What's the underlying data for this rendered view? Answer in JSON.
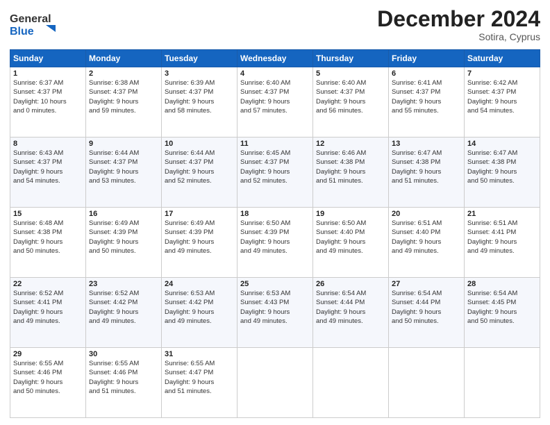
{
  "header": {
    "logo_line1": "General",
    "logo_line2": "Blue",
    "month": "December 2024",
    "location": "Sotira, Cyprus"
  },
  "weekdays": [
    "Sunday",
    "Monday",
    "Tuesday",
    "Wednesday",
    "Thursday",
    "Friday",
    "Saturday"
  ],
  "weeks": [
    [
      {
        "day": "1",
        "sr": "6:37 AM",
        "ss": "4:37 PM",
        "dl": "10 hours and 0 minutes."
      },
      {
        "day": "2",
        "sr": "6:38 AM",
        "ss": "4:37 PM",
        "dl": "9 hours and 59 minutes."
      },
      {
        "day": "3",
        "sr": "6:39 AM",
        "ss": "4:37 PM",
        "dl": "9 hours and 58 minutes."
      },
      {
        "day": "4",
        "sr": "6:40 AM",
        "ss": "4:37 PM",
        "dl": "9 hours and 57 minutes."
      },
      {
        "day": "5",
        "sr": "6:40 AM",
        "ss": "4:37 PM",
        "dl": "9 hours and 56 minutes."
      },
      {
        "day": "6",
        "sr": "6:41 AM",
        "ss": "4:37 PM",
        "dl": "9 hours and 55 minutes."
      },
      {
        "day": "7",
        "sr": "6:42 AM",
        "ss": "4:37 PM",
        "dl": "9 hours and 54 minutes."
      }
    ],
    [
      {
        "day": "8",
        "sr": "6:43 AM",
        "ss": "4:37 PM",
        "dl": "9 hours and 54 minutes."
      },
      {
        "day": "9",
        "sr": "6:44 AM",
        "ss": "4:37 PM",
        "dl": "9 hours and 53 minutes."
      },
      {
        "day": "10",
        "sr": "6:44 AM",
        "ss": "4:37 PM",
        "dl": "9 hours and 52 minutes."
      },
      {
        "day": "11",
        "sr": "6:45 AM",
        "ss": "4:37 PM",
        "dl": "9 hours and 52 minutes."
      },
      {
        "day": "12",
        "sr": "6:46 AM",
        "ss": "4:38 PM",
        "dl": "9 hours and 51 minutes."
      },
      {
        "day": "13",
        "sr": "6:47 AM",
        "ss": "4:38 PM",
        "dl": "9 hours and 51 minutes."
      },
      {
        "day": "14",
        "sr": "6:47 AM",
        "ss": "4:38 PM",
        "dl": "9 hours and 50 minutes."
      }
    ],
    [
      {
        "day": "15",
        "sr": "6:48 AM",
        "ss": "4:38 PM",
        "dl": "9 hours and 50 minutes."
      },
      {
        "day": "16",
        "sr": "6:49 AM",
        "ss": "4:39 PM",
        "dl": "9 hours and 50 minutes."
      },
      {
        "day": "17",
        "sr": "6:49 AM",
        "ss": "4:39 PM",
        "dl": "9 hours and 49 minutes."
      },
      {
        "day": "18",
        "sr": "6:50 AM",
        "ss": "4:39 PM",
        "dl": "9 hours and 49 minutes."
      },
      {
        "day": "19",
        "sr": "6:50 AM",
        "ss": "4:40 PM",
        "dl": "9 hours and 49 minutes."
      },
      {
        "day": "20",
        "sr": "6:51 AM",
        "ss": "4:40 PM",
        "dl": "9 hours and 49 minutes."
      },
      {
        "day": "21",
        "sr": "6:51 AM",
        "ss": "4:41 PM",
        "dl": "9 hours and 49 minutes."
      }
    ],
    [
      {
        "day": "22",
        "sr": "6:52 AM",
        "ss": "4:41 PM",
        "dl": "9 hours and 49 minutes."
      },
      {
        "day": "23",
        "sr": "6:52 AM",
        "ss": "4:42 PM",
        "dl": "9 hours and 49 minutes."
      },
      {
        "day": "24",
        "sr": "6:53 AM",
        "ss": "4:42 PM",
        "dl": "9 hours and 49 minutes."
      },
      {
        "day": "25",
        "sr": "6:53 AM",
        "ss": "4:43 PM",
        "dl": "9 hours and 49 minutes."
      },
      {
        "day": "26",
        "sr": "6:54 AM",
        "ss": "4:44 PM",
        "dl": "9 hours and 49 minutes."
      },
      {
        "day": "27",
        "sr": "6:54 AM",
        "ss": "4:44 PM",
        "dl": "9 hours and 50 minutes."
      },
      {
        "day": "28",
        "sr": "6:54 AM",
        "ss": "4:45 PM",
        "dl": "9 hours and 50 minutes."
      }
    ],
    [
      {
        "day": "29",
        "sr": "6:55 AM",
        "ss": "4:46 PM",
        "dl": "9 hours and 50 minutes."
      },
      {
        "day": "30",
        "sr": "6:55 AM",
        "ss": "4:46 PM",
        "dl": "9 hours and 51 minutes."
      },
      {
        "day": "31",
        "sr": "6:55 AM",
        "ss": "4:47 PM",
        "dl": "9 hours and 51 minutes."
      },
      null,
      null,
      null,
      null
    ]
  ],
  "labels": {
    "sunrise": "Sunrise:",
    "sunset": "Sunset:",
    "daylight": "Daylight:"
  }
}
